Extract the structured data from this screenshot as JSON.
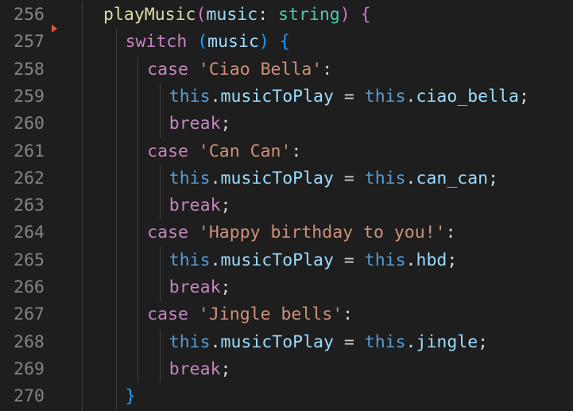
{
  "editor": {
    "lines": [
      {
        "num": "256",
        "indent": 0,
        "tokens": [
          {
            "text": "playMusic",
            "cls": "t-fn"
          },
          {
            "text": "(",
            "cls": "t-b1"
          },
          {
            "text": "music",
            "cls": "t-param"
          },
          {
            "text": ": ",
            "cls": "t-plain"
          },
          {
            "text": "string",
            "cls": "t-type"
          },
          {
            "text": ")",
            "cls": "t-b1"
          },
          {
            "text": " ",
            "cls": "t-plain"
          },
          {
            "text": "{",
            "cls": "t-b1"
          }
        ]
      },
      {
        "num": "257",
        "indent": 1,
        "tokens": [
          {
            "text": "switch",
            "cls": "t-ctrl"
          },
          {
            "text": " ",
            "cls": "t-plain"
          },
          {
            "text": "(",
            "cls": "t-b2"
          },
          {
            "text": "music",
            "cls": "t-param"
          },
          {
            "text": ")",
            "cls": "t-b2"
          },
          {
            "text": " ",
            "cls": "t-plain"
          },
          {
            "text": "{",
            "cls": "t-b2"
          }
        ]
      },
      {
        "num": "258",
        "indent": 2,
        "tokens": [
          {
            "text": "case",
            "cls": "t-ctrl"
          },
          {
            "text": " ",
            "cls": "t-plain"
          },
          {
            "text": "'Ciao Bella'",
            "cls": "t-str"
          },
          {
            "text": ":",
            "cls": "t-plain"
          }
        ]
      },
      {
        "num": "259",
        "indent": 3,
        "tokens": [
          {
            "text": "this",
            "cls": "t-this"
          },
          {
            "text": ".",
            "cls": "t-plain"
          },
          {
            "text": "musicToPlay",
            "cls": "t-prop"
          },
          {
            "text": " = ",
            "cls": "t-plain"
          },
          {
            "text": "this",
            "cls": "t-this"
          },
          {
            "text": ".",
            "cls": "t-plain"
          },
          {
            "text": "ciao_bella",
            "cls": "t-prop"
          },
          {
            "text": ";",
            "cls": "t-plain"
          }
        ]
      },
      {
        "num": "260",
        "indent": 3,
        "tokens": [
          {
            "text": "break",
            "cls": "t-ctrl"
          },
          {
            "text": ";",
            "cls": "t-plain"
          }
        ]
      },
      {
        "num": "261",
        "indent": 2,
        "tokens": [
          {
            "text": "case",
            "cls": "t-ctrl"
          },
          {
            "text": " ",
            "cls": "t-plain"
          },
          {
            "text": "'Can Can'",
            "cls": "t-str"
          },
          {
            "text": ":",
            "cls": "t-plain"
          }
        ]
      },
      {
        "num": "262",
        "indent": 3,
        "tokens": [
          {
            "text": "this",
            "cls": "t-this"
          },
          {
            "text": ".",
            "cls": "t-plain"
          },
          {
            "text": "musicToPlay",
            "cls": "t-prop"
          },
          {
            "text": " = ",
            "cls": "t-plain"
          },
          {
            "text": "this",
            "cls": "t-this"
          },
          {
            "text": ".",
            "cls": "t-plain"
          },
          {
            "text": "can_can",
            "cls": "t-prop"
          },
          {
            "text": ";",
            "cls": "t-plain"
          }
        ]
      },
      {
        "num": "263",
        "indent": 3,
        "tokens": [
          {
            "text": "break",
            "cls": "t-ctrl"
          },
          {
            "text": ";",
            "cls": "t-plain"
          }
        ]
      },
      {
        "num": "264",
        "indent": 2,
        "tokens": [
          {
            "text": "case",
            "cls": "t-ctrl"
          },
          {
            "text": " ",
            "cls": "t-plain"
          },
          {
            "text": "'Happy birthday to you!'",
            "cls": "t-str"
          },
          {
            "text": ":",
            "cls": "t-plain"
          }
        ]
      },
      {
        "num": "265",
        "indent": 3,
        "tokens": [
          {
            "text": "this",
            "cls": "t-this"
          },
          {
            "text": ".",
            "cls": "t-plain"
          },
          {
            "text": "musicToPlay",
            "cls": "t-prop"
          },
          {
            "text": " = ",
            "cls": "t-plain"
          },
          {
            "text": "this",
            "cls": "t-this"
          },
          {
            "text": ".",
            "cls": "t-plain"
          },
          {
            "text": "hbd",
            "cls": "t-prop"
          },
          {
            "text": ";",
            "cls": "t-plain"
          }
        ]
      },
      {
        "num": "266",
        "indent": 3,
        "tokens": [
          {
            "text": "break",
            "cls": "t-ctrl"
          },
          {
            "text": ";",
            "cls": "t-plain"
          }
        ]
      },
      {
        "num": "267",
        "indent": 2,
        "tokens": [
          {
            "text": "case",
            "cls": "t-ctrl"
          },
          {
            "text": " ",
            "cls": "t-plain"
          },
          {
            "text": "'Jingle bells'",
            "cls": "t-str"
          },
          {
            "text": ":",
            "cls": "t-plain"
          }
        ]
      },
      {
        "num": "268",
        "indent": 3,
        "tokens": [
          {
            "text": "this",
            "cls": "t-this"
          },
          {
            "text": ".",
            "cls": "t-plain"
          },
          {
            "text": "musicToPlay",
            "cls": "t-prop"
          },
          {
            "text": " = ",
            "cls": "t-plain"
          },
          {
            "text": "this",
            "cls": "t-this"
          },
          {
            "text": ".",
            "cls": "t-plain"
          },
          {
            "text": "jingle",
            "cls": "t-prop"
          },
          {
            "text": ";",
            "cls": "t-plain"
          }
        ]
      },
      {
        "num": "269",
        "indent": 3,
        "tokens": [
          {
            "text": "break",
            "cls": "t-ctrl"
          },
          {
            "text": ";",
            "cls": "t-plain"
          }
        ]
      },
      {
        "num": "270",
        "indent": 1,
        "tokens": [
          {
            "text": "}",
            "cls": "t-b2"
          }
        ]
      }
    ]
  }
}
